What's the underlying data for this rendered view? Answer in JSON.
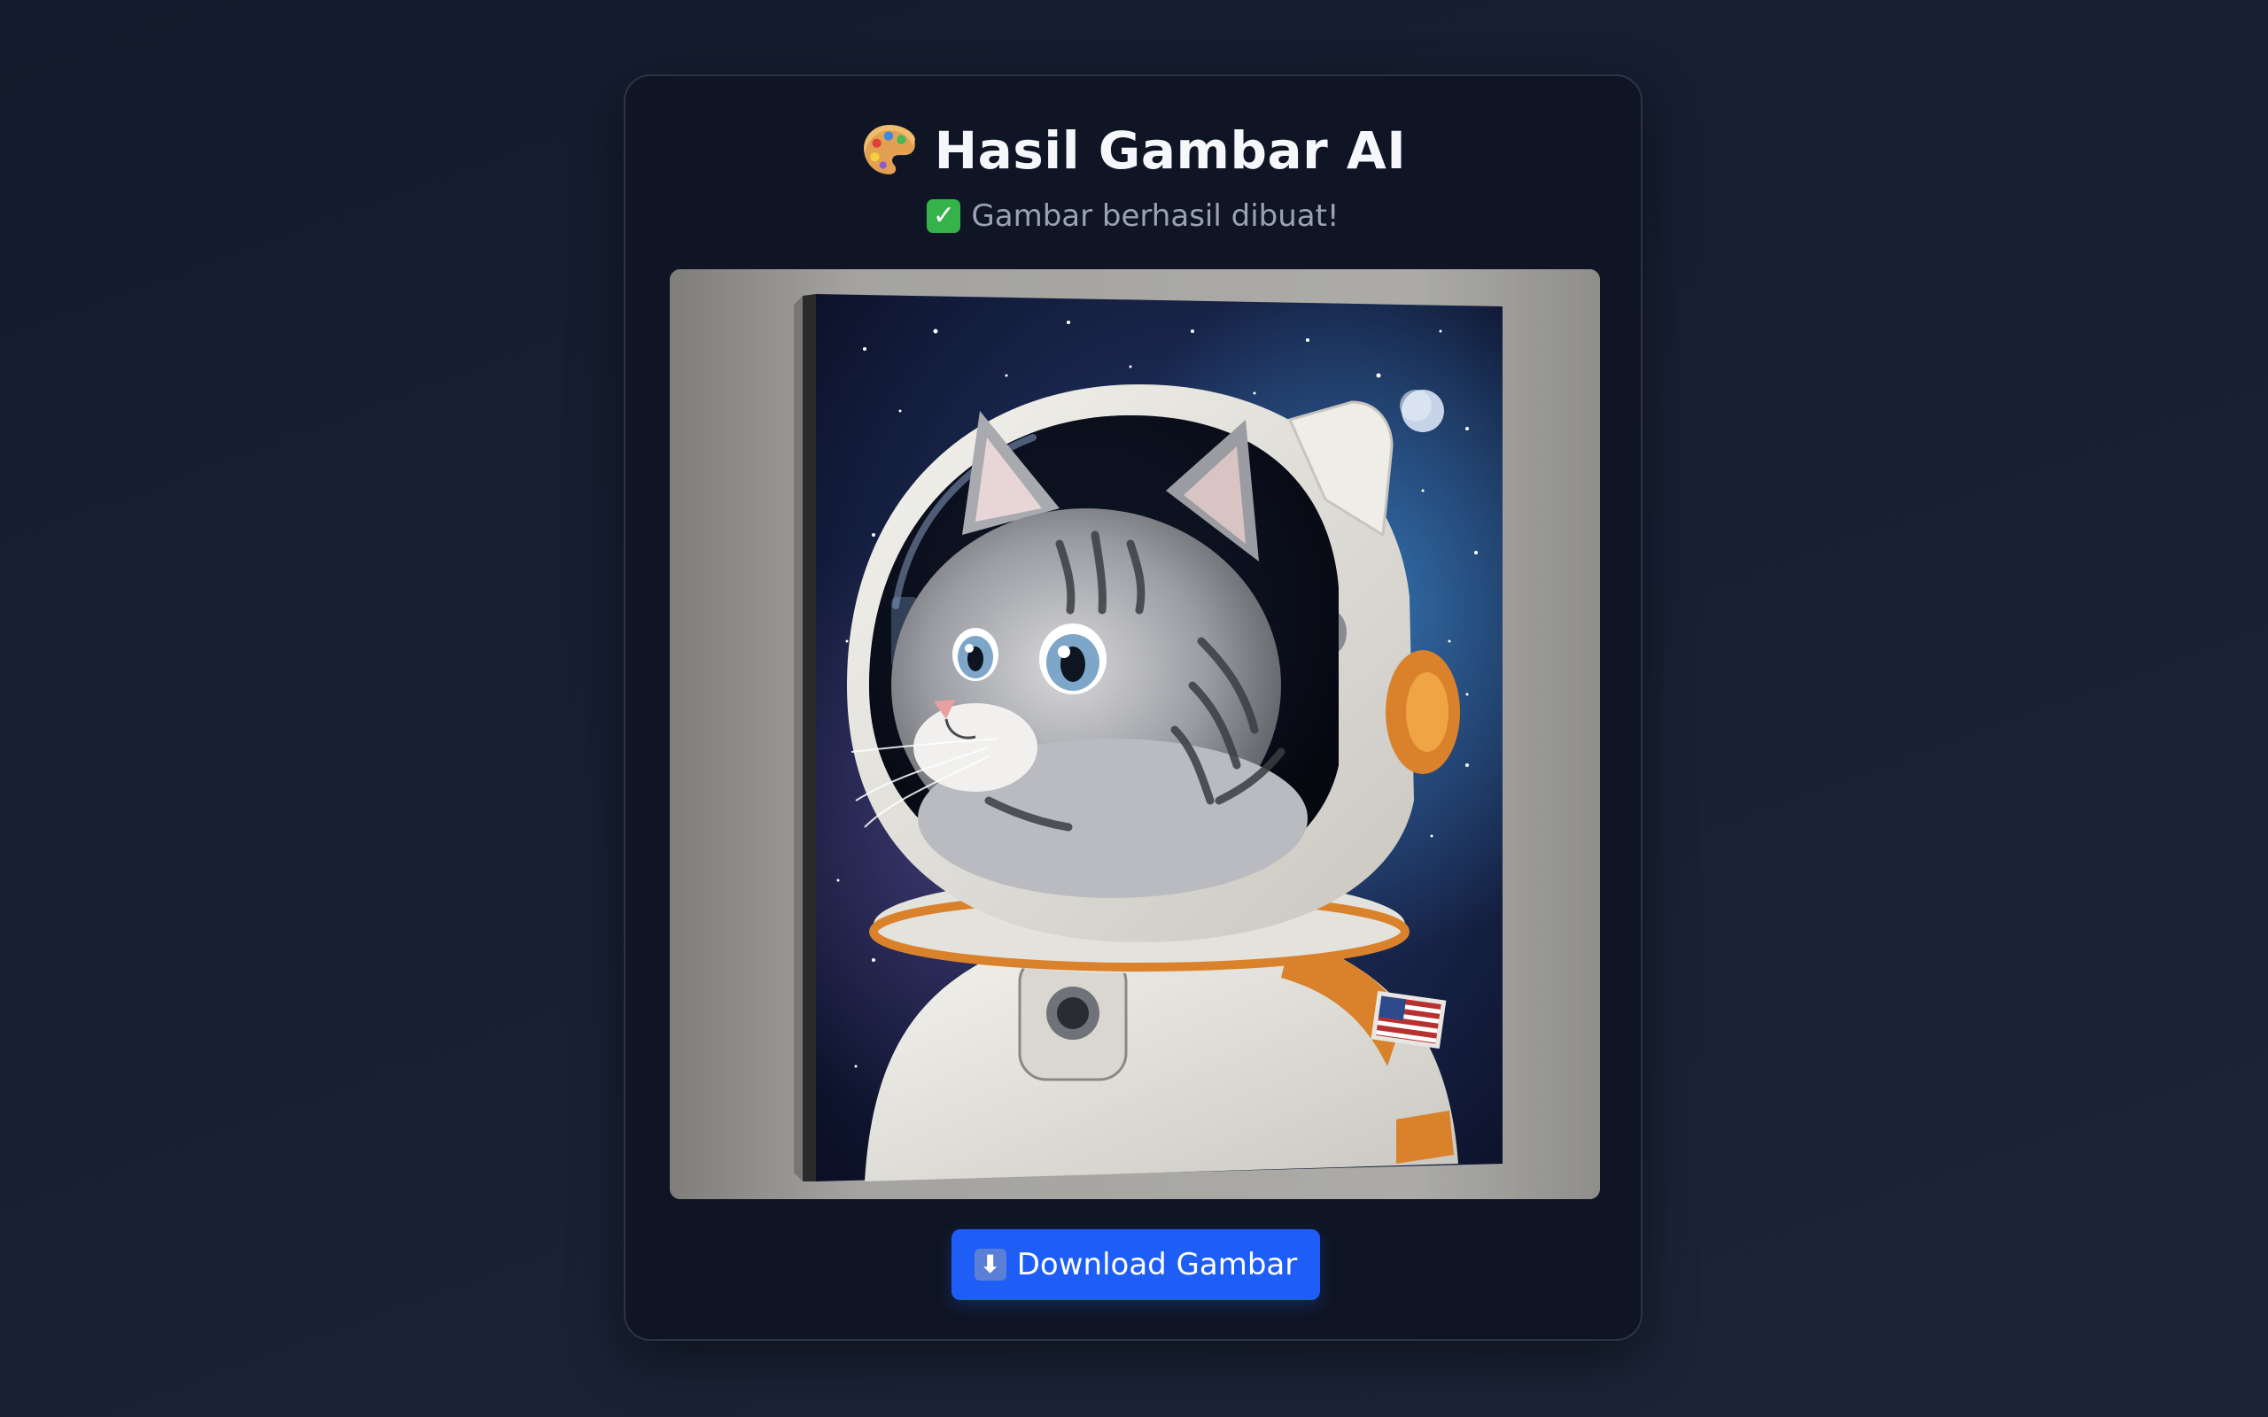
{
  "header": {
    "title": "Hasil Gambar AI",
    "title_icon": "palette-icon",
    "status": "Gambar berhasil dibuat!",
    "status_icon": "check-mark-icon"
  },
  "result_image": {
    "subject": "astronaut-cat-canvas"
  },
  "actions": {
    "download_label": "Download Gambar",
    "download_icon": "download-arrow-icon"
  },
  "colors": {
    "background": "#151d2e",
    "card": "#0f1524",
    "accent": "#1e5ef7",
    "success": "#36b24a"
  }
}
